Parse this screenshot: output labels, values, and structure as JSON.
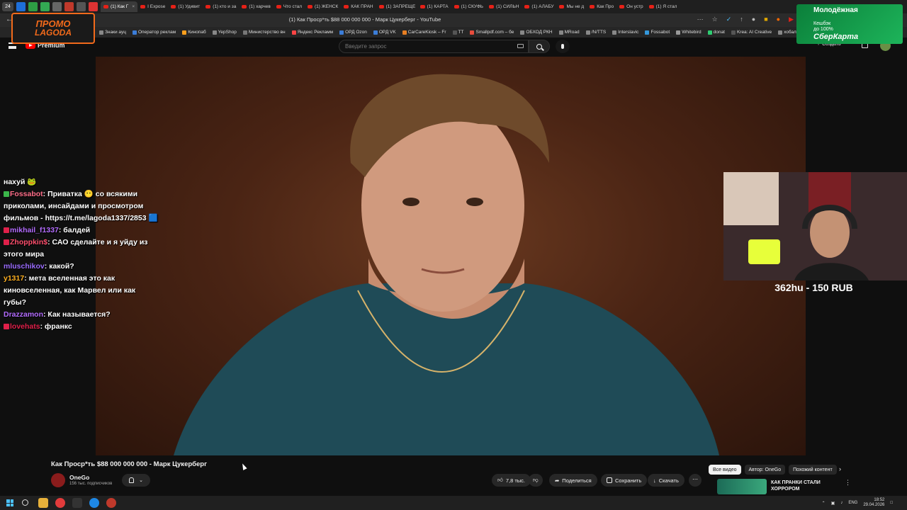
{
  "browser": {
    "tab_counter": "24",
    "tabs": [
      {
        "label": "(1) Как Г",
        "active": true
      },
      {
        "label": "I Expose",
        "active": false
      },
      {
        "label": "(1) Удивит",
        "active": false
      },
      {
        "label": "(1) кто и за",
        "active": false
      },
      {
        "label": "(1) харчев",
        "active": false
      },
      {
        "label": "Что стал",
        "active": false
      },
      {
        "label": "(1) ЖЕНСК",
        "active": false
      },
      {
        "label": "КАК ПРАН",
        "active": false
      },
      {
        "label": "(1) ЗАПРЕЩЕ",
        "active": false
      },
      {
        "label": "(1) КАРТА",
        "active": false
      },
      {
        "label": "(1) СКУФЬ",
        "active": false
      },
      {
        "label": "(1) СИЛЬН",
        "active": false
      },
      {
        "label": "(1) АЛАБУ",
        "active": false
      },
      {
        "label": "Мы не д",
        "active": false
      },
      {
        "label": "Как Про",
        "active": false
      },
      {
        "label": "Он устр",
        "active": false
      },
      {
        "label": "(1) Я стал",
        "active": false
      }
    ],
    "page_title": "(1) Как Проср*ть $88 000 000 000 - Марк Цукерберг - YouTube",
    "bookmarks": [
      "Знаки ауц",
      "Оператор реклам",
      "Кинопаб",
      "YepShop",
      "Министерство вн",
      "Яндекс Рекламм",
      "ОРД Ozon",
      "ОРД VK",
      "CarCareKiosk – Fr",
      "TT",
      "Smallpdf.com – бе",
      "ОБХОД РКН",
      "MRoad",
      "/N/TTS",
      "Interslavic",
      "Fossabot",
      "Whitebird",
      "donat",
      "Krea: AI Creative",
      "хобальт"
    ]
  },
  "youtube": {
    "logo_text": "Premium",
    "search_placeholder": "Введите запрос",
    "create_label": "Создать",
    "video_title": "Как Проср*ть $88 000 000 000 - Марк Цукерберг",
    "channel_name": "OneGo",
    "subscribers": "156 тыс. подписчиков",
    "likes": "7,8 тыс.",
    "share_label": "Поделиться",
    "save_label": "Сохранить",
    "download_label": "Скачать",
    "chips": [
      "Все видео",
      "Автор: OneGo",
      "Похожий контент"
    ],
    "recommended_title": "КАК ПРАНКИ СТАЛИ ХОРРОРОМ"
  },
  "overlay": {
    "promo_line1": "ПРОМО",
    "promo_line2": "LAGODA",
    "ad_headline": "Молодёжная",
    "ad_text1": "Кешбэк",
    "ad_text2": "до 100%",
    "ad_brand": "СберКарта",
    "donation_text": "362hu - 150 RUB",
    "chat": [
      {
        "user": "",
        "text": "нахуй 🐸",
        "color": "#ffffff",
        "badge": ""
      },
      {
        "user": "Fossabot",
        "text": ": Приватка 😶 со всякими приколами, инсайдами и просмотром фильмов - https://t.me/lagoda1337/2853 🟦",
        "color": "#ff6f8a",
        "badge": "green"
      },
      {
        "user": "mikhail_f1337",
        "text": ": балдей",
        "color": "#b36cff",
        "badge": "red"
      },
      {
        "user": "Zhoppkin$",
        "text": ": САО сделайте и я уйду из этого мира",
        "color": "#ff4f6d",
        "badge": "red"
      },
      {
        "user": "mluschikov",
        "text": ": какой?",
        "color": "#9b6cff",
        "badge": ""
      },
      {
        "user": "y1317",
        "text": ": мета вселенная это как киновселенная, как Марвел или как губы?",
        "color": "#ffb020",
        "badge": ""
      },
      {
        "user": "Drazzamon",
        "text": ": Как называется?",
        "color": "#b36cff",
        "badge": ""
      },
      {
        "user": "lovehats",
        "text": ": франкс",
        "color": "#e0204a",
        "badge": "red"
      }
    ]
  },
  "taskbar": {
    "lang": "ENG",
    "time": "18:52",
    "date": "29.04.2026"
  }
}
